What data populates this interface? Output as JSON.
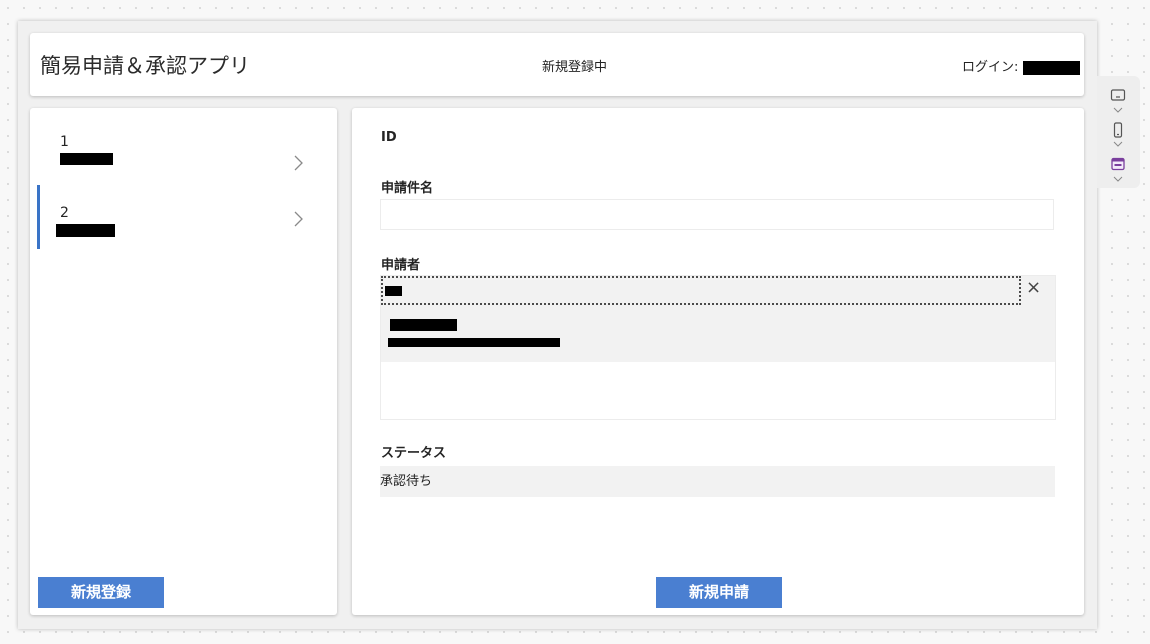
{
  "header": {
    "title": "簡易申請＆承認アプリ",
    "mode": "新規登録中",
    "login_label": "ログイン:"
  },
  "list": {
    "items": [
      {
        "id": "1",
        "selected": false
      },
      {
        "id": "2",
        "selected": true
      }
    ],
    "new_button": "新規登録"
  },
  "form": {
    "id_label": "ID",
    "title_label": "申請件名",
    "title_value": "",
    "applicant_label": "申請者",
    "clear_icon": "×",
    "status_label": "ステータス",
    "status_value": "承認待ち",
    "submit_button": "新規申請"
  },
  "side_tools": [
    "screen-icon",
    "phone-icon",
    "calendar-icon"
  ],
  "colors": {
    "accent": "#4a7fd1",
    "selected_bar": "#3a74c7"
  }
}
